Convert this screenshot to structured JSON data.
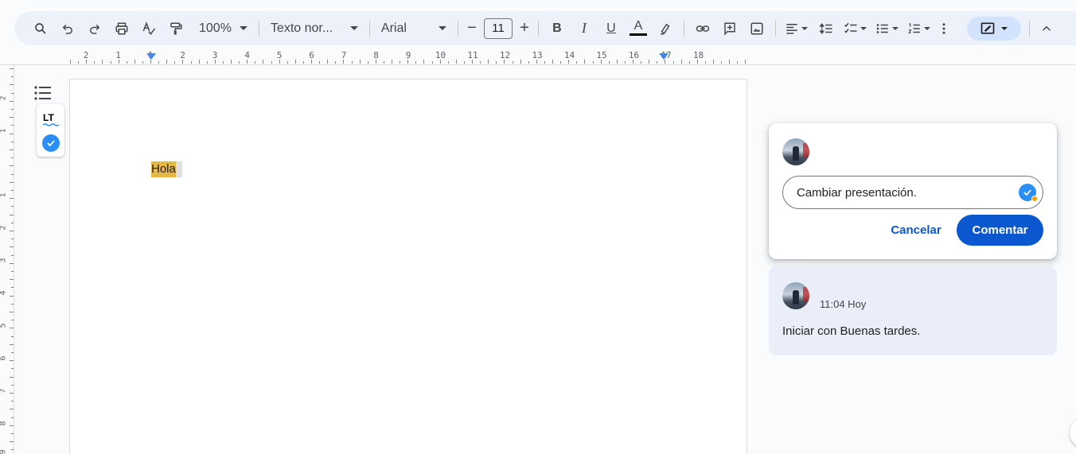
{
  "toolbar": {
    "zoom": "100%",
    "style": "Texto nor...",
    "font": "Arial",
    "font_size": "11",
    "minus": "−",
    "plus": "+"
  },
  "ruler": {
    "labels": [
      "2",
      "1",
      "1",
      "2",
      "3",
      "4",
      "5",
      "6",
      "7",
      "8",
      "9",
      "10",
      "11",
      "12",
      "13",
      "14",
      "15",
      "16",
      "17",
      "18"
    ],
    "vertical_labels": [
      "2",
      "1",
      "1",
      "2",
      "3",
      "4",
      "5",
      "6",
      "7",
      "8",
      "9"
    ]
  },
  "sidebar": {
    "lt_logo": "LT"
  },
  "document": {
    "text": "Hola"
  },
  "new_comment": {
    "input_value": "Cambiar presentación.",
    "cancel_label": "Cancelar",
    "submit_label": "Comentar"
  },
  "existing_comment": {
    "time": "11:04 Hoy",
    "text": "Iniciar con Buenas tardes."
  },
  "colors": {
    "accent": "#0b57d0",
    "highlight": "#e6b843",
    "toolbar_bg": "#edf2fa"
  }
}
